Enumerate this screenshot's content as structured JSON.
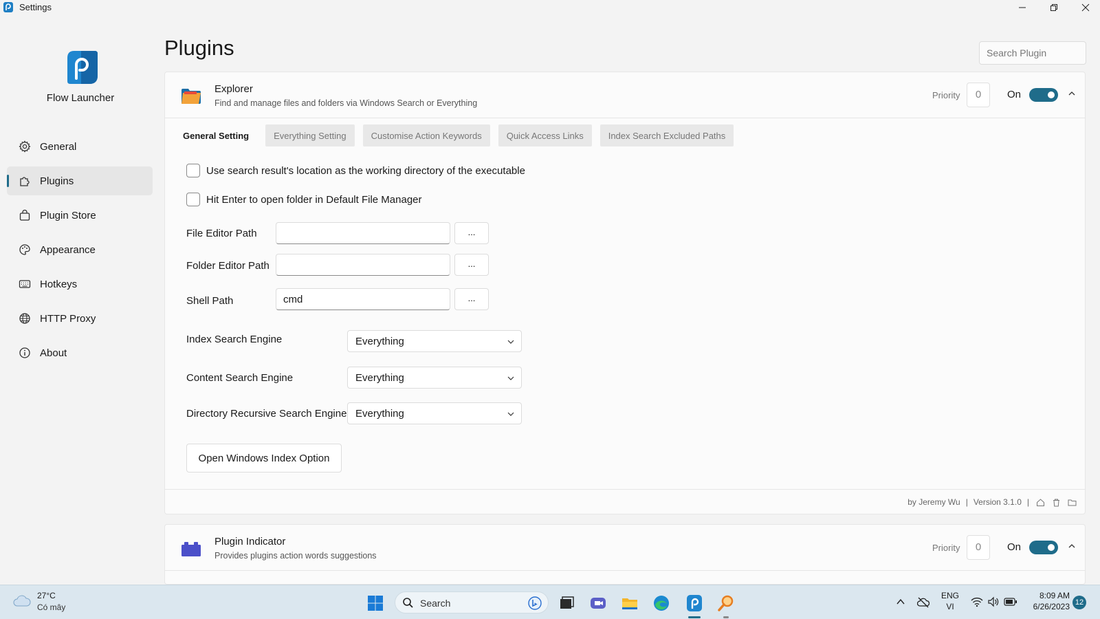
{
  "window": {
    "title": "Settings"
  },
  "sidebar": {
    "brand": "Flow Launcher",
    "items": [
      {
        "label": "General",
        "icon": "gear-icon"
      },
      {
        "label": "Plugins",
        "icon": "puzzle-icon",
        "active": true
      },
      {
        "label": "Plugin Store",
        "icon": "shopping-bag-icon"
      },
      {
        "label": "Appearance",
        "icon": "palette-icon"
      },
      {
        "label": "Hotkeys",
        "icon": "keyboard-icon"
      },
      {
        "label": "HTTP Proxy",
        "icon": "globe-icon"
      },
      {
        "label": "About",
        "icon": "info-icon"
      }
    ]
  },
  "main": {
    "title": "Plugins",
    "search_placeholder": "Search Plugin"
  },
  "explorer": {
    "name": "Explorer",
    "description": "Find and manage files and folders via Windows Search or Everything",
    "priority_label": "Priority",
    "priority": "0",
    "state": "On",
    "tabs": [
      "General Setting",
      "Everything Setting",
      "Customise Action Keywords",
      "Quick Access Links",
      "Index Search Excluded Paths"
    ],
    "checkboxes": [
      "Use search result's location as the working directory of the executable",
      "Hit Enter to open folder in Default File Manager"
    ],
    "paths": [
      {
        "label": "File Editor Path",
        "value": ""
      },
      {
        "label": "Folder Editor Path",
        "value": ""
      },
      {
        "label": "Shell Path",
        "value": "cmd"
      }
    ],
    "browse_label": "...",
    "engines": [
      {
        "label": "Index Search Engine",
        "value": "Everything"
      },
      {
        "label": "Content Search Engine",
        "value": "Everything"
      },
      {
        "label": "Directory Recursive Search Engine",
        "value": "Everything"
      }
    ],
    "open_index_button": "Open Windows Index Option",
    "footer": {
      "author": "by Jeremy Wu",
      "separator": "|",
      "version": "Version 3.1.0"
    }
  },
  "plugin_indicator": {
    "name": "Plugin Indicator",
    "description": "Provides plugins action words suggestions",
    "priority_label": "Priority",
    "priority": "0",
    "state": "On"
  },
  "taskbar": {
    "weather_temp": "27°C",
    "weather_condition": "Có mây",
    "search_label": "Search",
    "language_top": "ENG",
    "language_bottom": "VI",
    "time": "8:09 AM",
    "date": "6/26/2023",
    "notification_count": "12"
  },
  "colors": {
    "accent": "#1f6c8a",
    "background": "#f3f3f3",
    "card": "#fbfbfb",
    "taskbar": "#dbe7ef"
  }
}
